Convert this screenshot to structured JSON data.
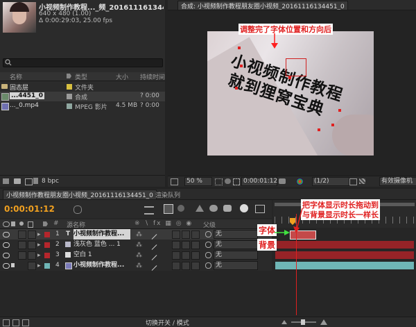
{
  "project": {
    "thumb_title": "小视频制作教程..._频_20161116134451_0",
    "thumb_dim": "640 x 480 (1.00)",
    "thumb_time": "Δ 0:00:29:03, 25.00 fps",
    "search_icon": "magnifier",
    "col_name": "名称",
    "col_type": "类型",
    "col_size": "大小",
    "col_duration": "持续时间",
    "items": [
      {
        "name": "固态层",
        "type": "文件夹",
        "size": "",
        "dur": ""
      },
      {
        "name": "...4451_0",
        "type": "合成",
        "size": "",
        "dur": "? 0:00"
      },
      {
        "name": "..._0.mp4",
        "type": "MPEG 影片",
        "size": "4.5 MB",
        "dur": "? 0:00"
      }
    ],
    "bpc": "8 bpc"
  },
  "viewer": {
    "tab": "合成: 小视频制作教程朋友圈小视频_20161116134451_0",
    "text_line1": "小视频制作教程",
    "text_line2": "就到狸窝宝典",
    "annotation_top": "调整完了字体位置和方向后",
    "zoom": "50 %",
    "timecode": "0:00:01:12",
    "resolution": "(1/2)",
    "camera": "有效摄像机"
  },
  "timeline": {
    "tab_comp": "小视频制作教程朋友圈小视频_20161116134451_0",
    "tab_render": "渲染队列",
    "timecode": "0:00:01:12",
    "col_source": "源名称",
    "col_parent": "父级",
    "layers": [
      {
        "num": "1",
        "kind": "T",
        "name": "小视频制作教程...",
        "color": "#b5262c",
        "parent": "无"
      },
      {
        "num": "2",
        "kind": "",
        "name": "浅灰色 蓝色 ... 1",
        "color": "#b5262c",
        "parent": "无"
      },
      {
        "num": "3",
        "kind": "",
        "name": "空白 1",
        "color": "#b5262c",
        "parent": "无"
      },
      {
        "num": "4",
        "kind": "",
        "name": "小视频制作教程...",
        "color": "#6fb6b6",
        "parent": "无"
      }
    ],
    "annot_text_label": "字体",
    "annot_bg_label": "背景",
    "annot_right_1": "把字体显示时长拖动到",
    "annot_right_2": "与背景显示时长一样长",
    "footer": "切换开关 / 模式"
  },
  "colors": {
    "accent_orange": "#f0a020",
    "annotation_red": "#ff2020",
    "layer_red": "#b5262c",
    "layer_teal": "#6fb6b6"
  }
}
